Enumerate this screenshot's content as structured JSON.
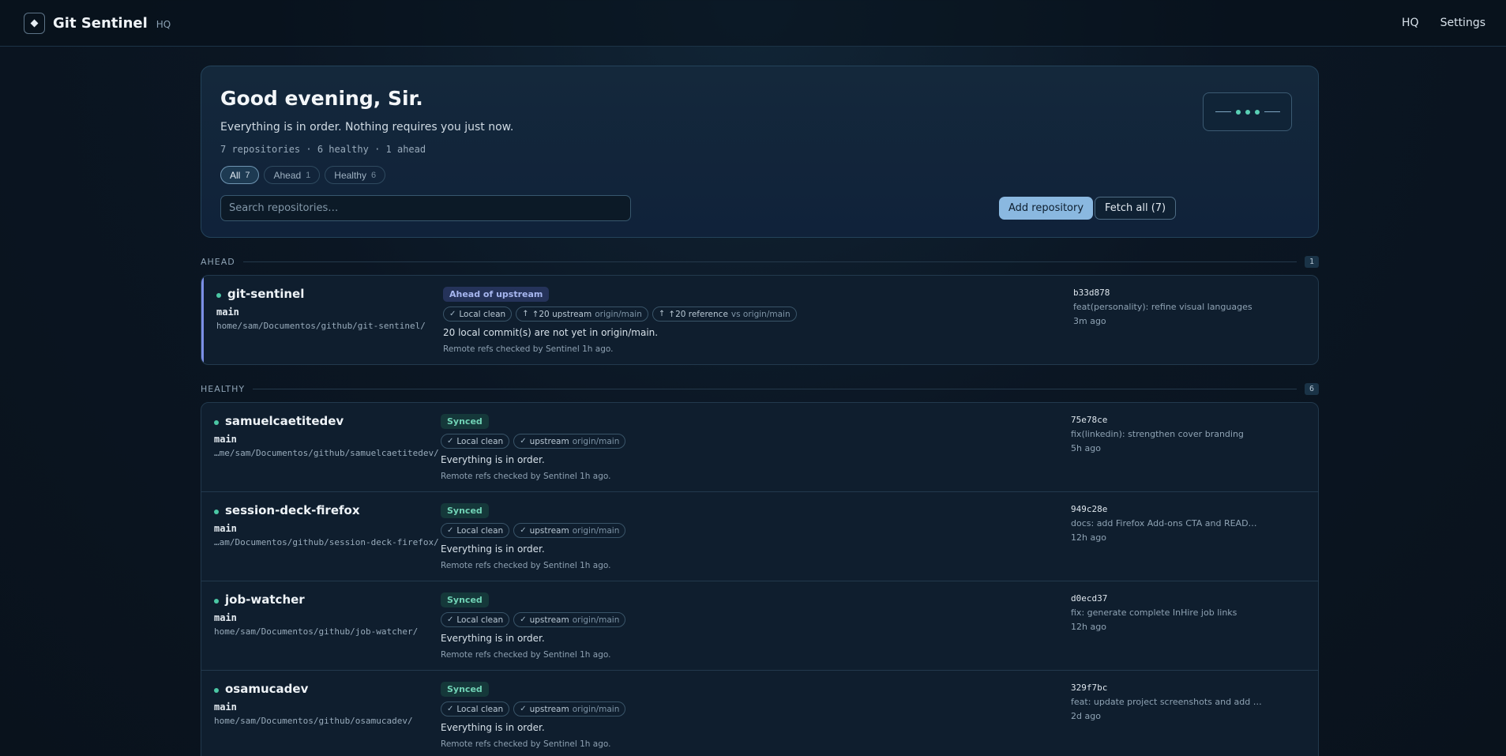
{
  "app": {
    "title": "Git Sentinel",
    "subtitle": "HQ"
  },
  "nav": {
    "hq": "HQ",
    "settings": "Settings"
  },
  "hero": {
    "greeting": "Good evening, Sir.",
    "status": "Everything is in order. Nothing requires you just now.",
    "summary": "7 repositories · 6 healthy · 1 ahead",
    "filters": [
      {
        "label": "All",
        "count": "7",
        "active": true
      },
      {
        "label": "Ahead",
        "count": "1",
        "active": false
      },
      {
        "label": "Healthy",
        "count": "6",
        "active": false
      }
    ],
    "search_placeholder": "Search repositories…",
    "add_label": "Add repository",
    "fetch_label": "Fetch all (7)"
  },
  "sections": {
    "ahead": {
      "label": "AHEAD",
      "count": "1"
    },
    "healthy": {
      "label": "HEALTHY",
      "count": "6"
    }
  },
  "colors": {
    "accent": "#8ab8e0",
    "healthy": "#4bc7a4",
    "ahead": "#7c8fe6",
    "background": "#0b1623"
  },
  "ahead_repos": [
    {
      "name": "git-sentinel",
      "branch": "main",
      "path": "home/sam/Documentos/github/git-sentinel/",
      "badge": "Ahead of upstream",
      "pills": [
        {
          "icon": "✓",
          "text": "Local clean",
          "ref": ""
        },
        {
          "icon": "↑",
          "text": "↑20 upstream",
          "ref": "origin/main"
        },
        {
          "icon": "↑",
          "text": "↑20 reference",
          "ref": "vs origin/main"
        }
      ],
      "note": "20 local commit(s) are not yet in origin/main.",
      "checked": "Remote refs checked by Sentinel 1h ago.",
      "sha": "b33d878",
      "message": "feat(personality): refine visual languages",
      "ago": "3m ago"
    }
  ],
  "healthy_repos": [
    {
      "name": "samuelcaetitedev",
      "branch": "main",
      "path": "…me/sam/Documentos/github/samuelcaetitedev/",
      "badge": "Synced",
      "pills": [
        {
          "icon": "✓",
          "text": "Local clean",
          "ref": ""
        },
        {
          "icon": "✓",
          "text": "upstream",
          "ref": "origin/main"
        }
      ],
      "note": "Everything is in order.",
      "checked": "Remote refs checked by Sentinel 1h ago.",
      "sha": "75e78ce",
      "message": "fix(linkedin): strengthen cover branding",
      "ago": "5h ago"
    },
    {
      "name": "session-deck-firefox",
      "branch": "main",
      "path": "…am/Documentos/github/session-deck-firefox/",
      "badge": "Synced",
      "pills": [
        {
          "icon": "✓",
          "text": "Local clean",
          "ref": ""
        },
        {
          "icon": "✓",
          "text": "upstream",
          "ref": "origin/main"
        }
      ],
      "note": "Everything is in order.",
      "checked": "Remote refs checked by Sentinel 1h ago.",
      "sha": "949c28e",
      "message": "docs: add Firefox Add-ons CTA and READ…",
      "ago": "12h ago"
    },
    {
      "name": "job-watcher",
      "branch": "main",
      "path": "home/sam/Documentos/github/job-watcher/",
      "badge": "Synced",
      "pills": [
        {
          "icon": "✓",
          "text": "Local clean",
          "ref": ""
        },
        {
          "icon": "✓",
          "text": "upstream",
          "ref": "origin/main"
        }
      ],
      "note": "Everything is in order.",
      "checked": "Remote refs checked by Sentinel 1h ago.",
      "sha": "d0ecd37",
      "message": "fix: generate complete InHire job links",
      "ago": "12h ago"
    },
    {
      "name": "osamucadev",
      "branch": "main",
      "path": "home/sam/Documentos/github/osamucadev/",
      "badge": "Synced",
      "pills": [
        {
          "icon": "✓",
          "text": "Local clean",
          "ref": ""
        },
        {
          "icon": "✓",
          "text": "upstream",
          "ref": "origin/main"
        }
      ],
      "note": "Everything is in order.",
      "checked": "Remote refs checked by Sentinel 1h ago.",
      "sha": "329f7bc",
      "message": "feat: update project screenshots and add …",
      "ago": "2d ago"
    }
  ]
}
